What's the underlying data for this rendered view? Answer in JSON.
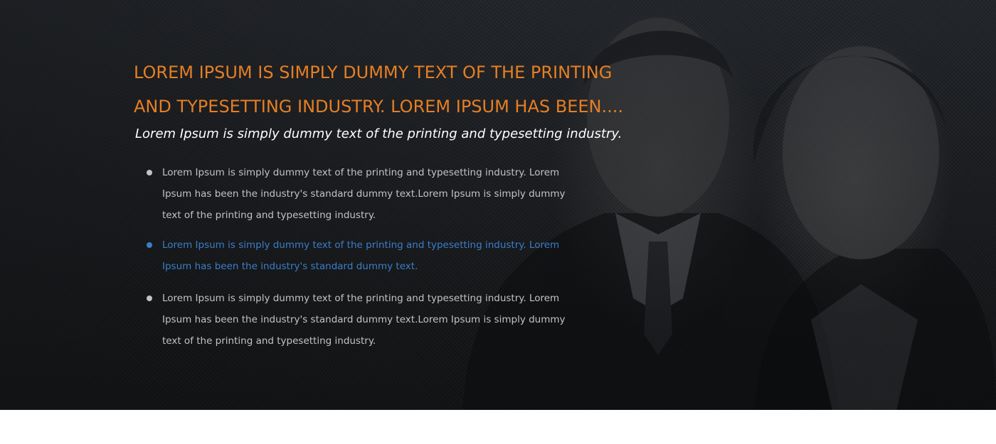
{
  "hero": {
    "headline": "LOREM IPSUM IS SIMPLY DUMMY TEXT OF THE PRINTING AND TYPESETTING INDUSTRY. LOREM IPSUM HAS BEEN....",
    "subheadline": "Lorem Ipsum is simply dummy text of the printing and typesetting industry.",
    "image": "business-couple-photo",
    "bullets": [
      {
        "text": "Lorem Ipsum is simply dummy text of the printing and typesetting industry. Lorem Ipsum has been the industry's standard dummy text.Lorem Ipsum is simply dummy text of the printing and typesetting industry.",
        "active": false
      },
      {
        "text": "Lorem Ipsum is simply dummy text of the printing and typesetting industry. Lorem Ipsum has been the industry's standard dummy text.",
        "active": true
      },
      {
        "text": "Lorem Ipsum is simply dummy text of the printing and typesetting industry. Lorem Ipsum has been the industry's standard dummy text.Lorem Ipsum is simply dummy text of the printing and typesetting industry.",
        "active": false
      }
    ]
  },
  "colors": {
    "headline": "#e57f24",
    "subheadline": "#ffffff",
    "bullet_text": "#c2c3c5",
    "bullet_active": "#3a7ec9",
    "background": "#1b1d20"
  }
}
